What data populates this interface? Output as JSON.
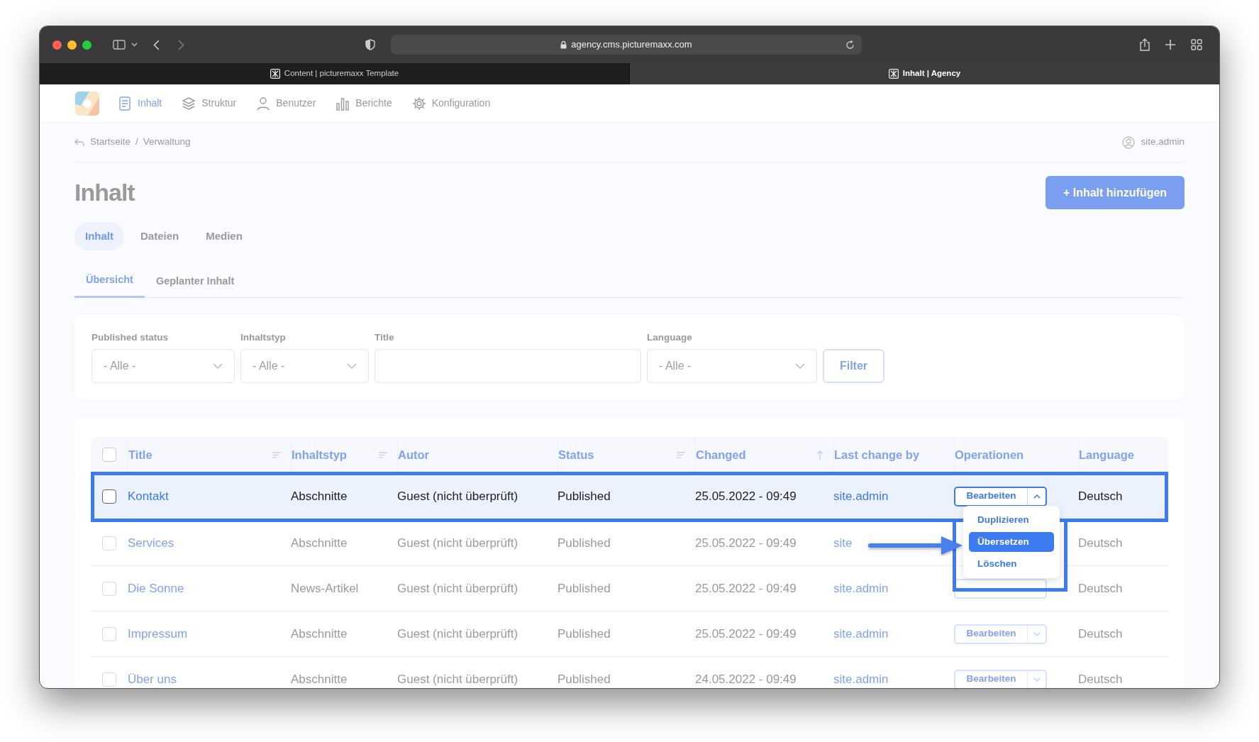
{
  "browser": {
    "url": "agency.cms.picturemaxx.com",
    "tabs": [
      {
        "title": "Content | picturemaxx Template",
        "selected": false
      },
      {
        "title": "Inhalt | Agency",
        "selected": true
      }
    ]
  },
  "nav": {
    "items": [
      {
        "label": "Inhalt",
        "selected": true
      },
      {
        "label": "Struktur",
        "selected": false
      },
      {
        "label": "Benutzer",
        "selected": false
      },
      {
        "label": "Berichte",
        "selected": false
      },
      {
        "label": "Konfiguration",
        "selected": false
      }
    ]
  },
  "breadcrumb": [
    "Startseite",
    "Verwaltung"
  ],
  "breadcrumb_separator": "/",
  "user": "site.admin",
  "page_title": "Inhalt",
  "add_button": "+ Inhalt hinzufügen",
  "tabs": [
    {
      "label": "Inhalt",
      "selected": true
    },
    {
      "label": "Dateien",
      "selected": false
    },
    {
      "label": "Medien",
      "selected": false
    }
  ],
  "subtabs": [
    {
      "label": "Übersicht",
      "selected": true
    },
    {
      "label": "Geplanter Inhalt",
      "selected": false
    }
  ],
  "filters": [
    {
      "label": "Published status",
      "kind": "select",
      "value": "- Alle -"
    },
    {
      "label": "Inhaltstyp",
      "kind": "select",
      "value": "- Alle -"
    },
    {
      "label": "Title",
      "kind": "text"
    },
    {
      "label": "Language",
      "kind": "select",
      "value": "- Alle -"
    }
  ],
  "filter_button": "Filter",
  "table": {
    "select_all_checked": false,
    "columns": [
      {
        "label": "Title",
        "kind": "filterable"
      },
      {
        "label": "Inhaltstyp",
        "kind": "filterable"
      },
      {
        "label": "Autor",
        "kind": "plain"
      },
      {
        "label": "Status",
        "kind": "filterable"
      },
      {
        "label": "Changed",
        "kind": "sorted"
      },
      {
        "label": "Last change by",
        "kind": "plain"
      },
      {
        "label": "Operationen",
        "kind": "plain"
      },
      {
        "label": "Language",
        "kind": "plain"
      }
    ],
    "rows": [
      {
        "checked": false,
        "highlighted": true,
        "title": "Kontakt",
        "type": "Abschnitte",
        "author": "Guest (nicht überprüft)",
        "status": "Published",
        "changed": "25.05.2022 - 09:49",
        "last_change_by": "site.admin",
        "operations": {
          "kind": "split",
          "label": "Bearbeiten",
          "expanded": true
        },
        "language": "Deutsch"
      },
      {
        "checked": false,
        "highlighted": false,
        "title": "Services",
        "type": "Abschnitte",
        "author": "Guest (nicht überprüft)",
        "status": "Published",
        "changed": "25.05.2022 - 09:49",
        "last_change_by": "site",
        "language": "Deutsch"
      },
      {
        "checked": false,
        "highlighted": false,
        "title": "Die Sonne",
        "type": "News-Artikel",
        "author": "Guest (nicht überprüft)",
        "status": "Published",
        "changed": "25.05.2022 - 09:49",
        "last_change_by": "site.admin",
        "operations": {
          "kind": "covered"
        },
        "language": "Deutsch"
      },
      {
        "checked": false,
        "highlighted": false,
        "title": "Impressum",
        "type": "Abschnitte",
        "author": "Guest (nicht überprüft)",
        "status": "Published",
        "changed": "25.05.2022 - 09:49",
        "last_change_by": "site.admin",
        "operations": {
          "kind": "split",
          "label": "Bearbeiten",
          "expanded": false
        },
        "language": "Deutsch"
      },
      {
        "checked": false,
        "highlighted": false,
        "title": "Über uns",
        "type": "Abschnitte",
        "author": "Guest (nicht überprüft)",
        "status": "Published",
        "changed": "24.05.2022 - 09:49",
        "last_change_by": "site.admin",
        "operations": {
          "kind": "split",
          "label": "Bearbeiten",
          "expanded": false
        },
        "language": "Deutsch"
      }
    ]
  },
  "operations_menu": [
    {
      "label": "Duplizieren",
      "selected": false
    },
    {
      "label": "Übersetzen",
      "selected": true
    },
    {
      "label": "Löschen",
      "selected": false
    }
  ]
}
